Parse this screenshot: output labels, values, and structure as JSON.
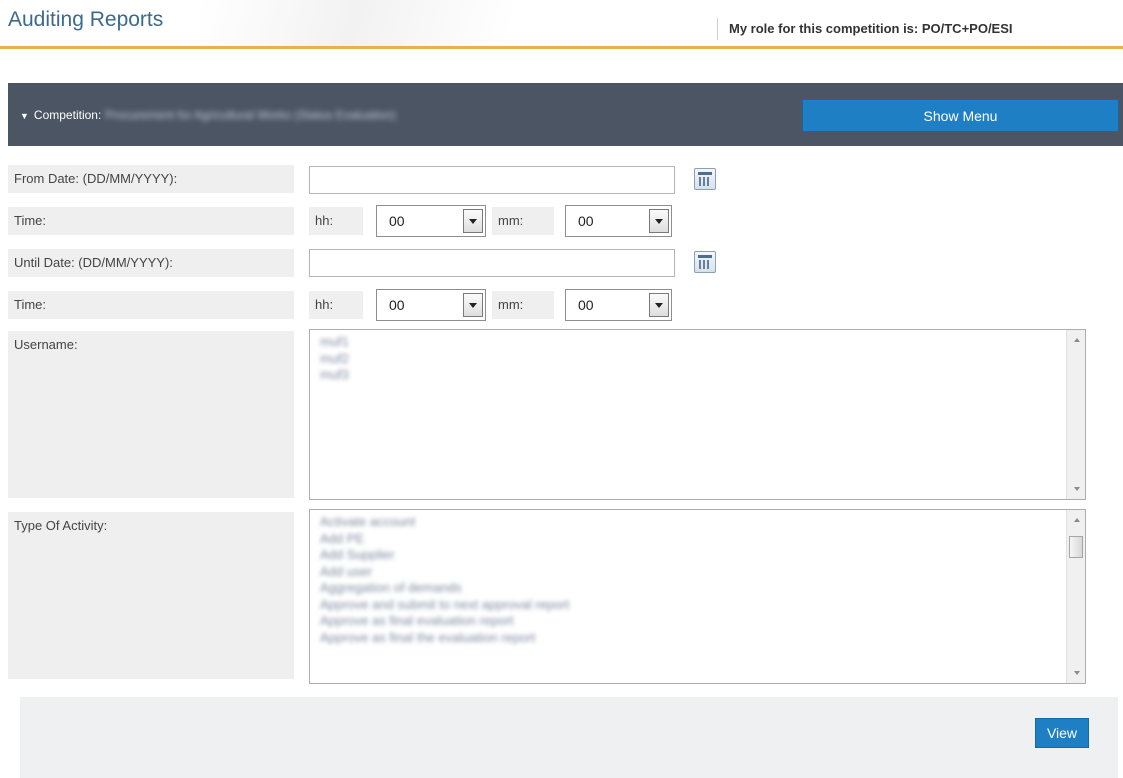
{
  "header": {
    "title": "Auditing Reports",
    "role_text": "My role for this competition is: PO/TC+PO/ESI"
  },
  "competition": {
    "label": "Competition:",
    "name": "Procurement for Agricultural Works (Status Evaluation)",
    "show_menu_label": "Show Menu"
  },
  "form": {
    "from_date_label": "From Date: (DD/MM/YYYY):",
    "from_date_value": "",
    "time_label": "Time:",
    "hh_label": "hh:",
    "mm_label": "mm:",
    "from_hh_value": "00",
    "from_mm_value": "00",
    "until_date_label": "Until Date: (DD/MM/YYYY):",
    "until_date_value": "",
    "until_hh_value": "00",
    "until_mm_value": "00",
    "username_label": "Username:",
    "usernames": [
      "muf1",
      "muf2",
      "muf3"
    ],
    "activity_label": "Type Of Activity:",
    "activities": [
      "Activate account",
      "Add PE",
      "Add Supplier",
      "Add user",
      "Aggregation of demands",
      "Approve and submit to next approval report",
      "Approve as final evaluation report",
      "Approve as final the evaluation report"
    ]
  },
  "footer": {
    "view_label": "View"
  },
  "colors": {
    "title": "#3d6a8c",
    "accent_rule": "#e3b448",
    "competition_bar": "#4b5563",
    "button_blue": "#1f7fc4"
  },
  "icons": {
    "calendar": "calendar-icon",
    "chevron": "chevron-down-icon",
    "dropdown": "dropdown-arrow-icon"
  }
}
